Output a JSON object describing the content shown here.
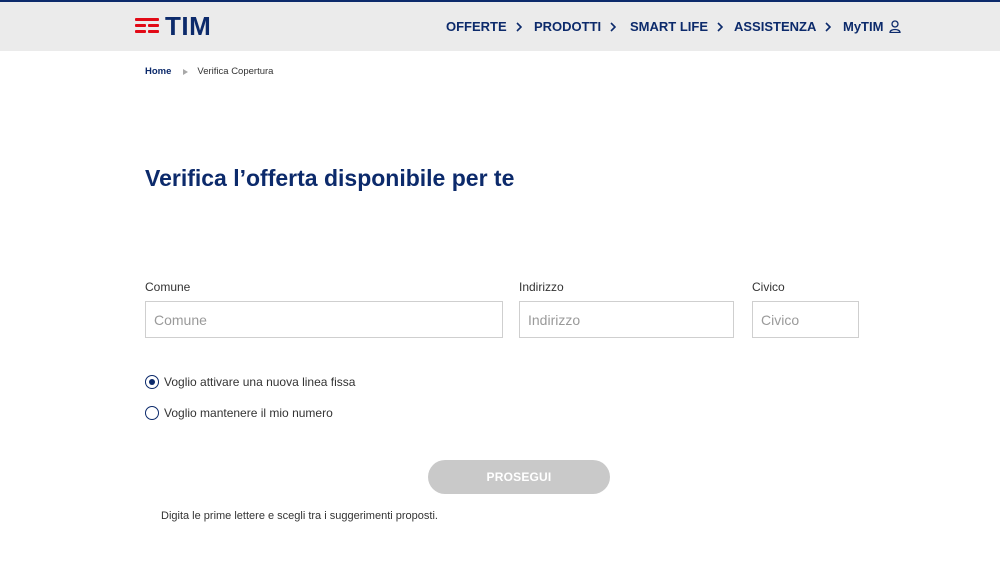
{
  "header": {
    "logo_text": "TIM",
    "nav": [
      {
        "label": "OFFERTE",
        "icon": "chevron-right-icon"
      },
      {
        "label": "PRODOTTI",
        "icon": "chevron-right-icon"
      },
      {
        "label": "SMART LIFE",
        "icon": "chevron-right-icon"
      },
      {
        "label": "ASSISTENZA",
        "icon": "chevron-right-icon"
      },
      {
        "label": "MyTIM",
        "icon": "user-icon"
      }
    ]
  },
  "breadcrumb": {
    "home": "Home",
    "separator_icon": "triangle-right-icon",
    "current": "Verifica Copertura"
  },
  "main": {
    "title": "Verifica l’offerta disponibile per te",
    "fields": {
      "comune": {
        "label": "Comune",
        "placeholder": "Comune",
        "value": ""
      },
      "indirizzo": {
        "label": "Indirizzo",
        "placeholder": "Indirizzo",
        "value": ""
      },
      "civico": {
        "label": "Civico",
        "placeholder": "Civico",
        "value": ""
      }
    },
    "options": [
      {
        "label": "Voglio attivare una nuova linea fissa",
        "checked": true
      },
      {
        "label": "Voglio mantenere il mio numero",
        "checked": false
      }
    ],
    "submit_label": "PROSEGUI",
    "hint": "Digita le prime lettere e scegli tra i suggerimenti proposti."
  },
  "colors": {
    "brand_blue": "#0c2a6b",
    "brand_red": "#e20a16",
    "header_bg": "#ebebeb",
    "button_disabled": "#c9c9c9"
  }
}
